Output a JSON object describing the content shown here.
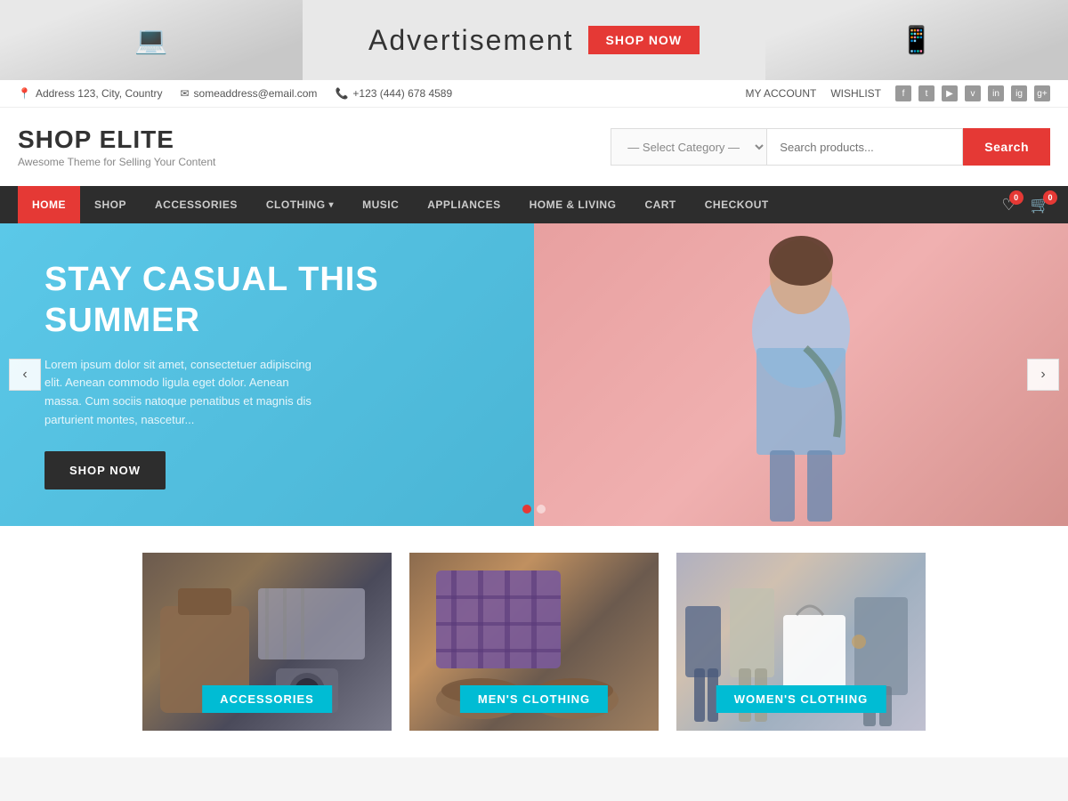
{
  "adBanner": {
    "title": "Advertisement",
    "btnLabel": "SHOP NOW",
    "leftDeco": "💻",
    "rightDeco": "📱"
  },
  "infoBar": {
    "address": "Address 123, City, Country",
    "email": "someaddress@email.com",
    "phone": "+123 (444) 678 4589",
    "myAccount": "MY ACCOUNT",
    "wishlist": "WISHLIST"
  },
  "header": {
    "logoTitle": "SHOP ELITE",
    "logoSubtitle": "Awesome Theme for Selling Your Content",
    "categoryPlaceholder": "— Select Category —",
    "searchPlaceholder": "Search products...",
    "searchBtn": "Search"
  },
  "nav": {
    "items": [
      {
        "label": "HOME",
        "active": true
      },
      {
        "label": "SHOP",
        "active": false
      },
      {
        "label": "ACCESSORIES",
        "active": false
      },
      {
        "label": "CLOTHING",
        "active": false,
        "hasDropdown": true
      },
      {
        "label": "MUSIC",
        "active": false
      },
      {
        "label": "APPLIANCES",
        "active": false
      },
      {
        "label": "HOME & LIVING",
        "active": false
      },
      {
        "label": "CART",
        "active": false
      },
      {
        "label": "CHECKOUT",
        "active": false
      }
    ],
    "wishlistCount": "0",
    "cartCount": "0"
  },
  "hero": {
    "title": "STAY CASUAL THIS SUMMER",
    "description": "Lorem ipsum dolor sit amet, consectetuer adipiscing elit. Aenean commodo ligula eget dolor. Aenean massa. Cum sociis natoque penatibus et magnis dis parturient montes, nascetur...",
    "btnLabel": "SHOP NOW",
    "dots": [
      {
        "active": true
      },
      {
        "active": false
      }
    ]
  },
  "categories": [
    {
      "label": "ACCESSORIES",
      "bgClass": "cat-acc-bg"
    },
    {
      "label": "MEN'S CLOTHING",
      "bgClass": "cat-mens-bg"
    },
    {
      "label": "WOMEN'S CLOTHING",
      "bgClass": "cat-womens-bg"
    }
  ],
  "icons": {
    "location": "📍",
    "email": "✉",
    "phone": "📞",
    "heart": "♡",
    "cart": "🛒",
    "prev": "‹",
    "next": "›",
    "chevron": "▾",
    "facebook": "f",
    "twitter": "t",
    "youtube": "y",
    "vimeo": "v",
    "linkedin": "in",
    "instagram": "ig",
    "googleplus": "g+"
  }
}
